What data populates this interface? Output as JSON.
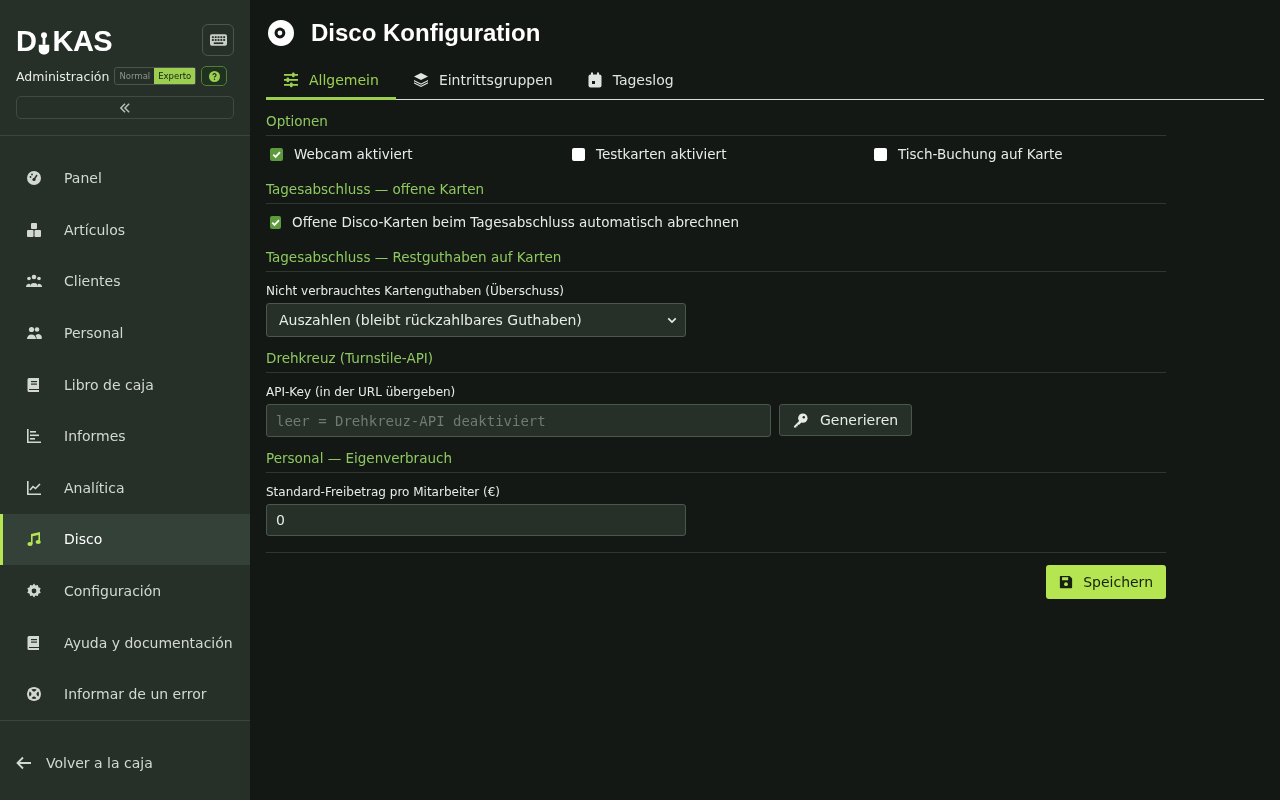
{
  "sidebar": {
    "logo": [
      "D",
      "KAS"
    ],
    "subtitle": "Administración",
    "mode_toggle": [
      {
        "label": "Normal",
        "selected": false
      },
      {
        "label": "Experto",
        "selected": true
      }
    ],
    "items": [
      {
        "label": "Panel",
        "selected": false
      },
      {
        "label": "Artículos",
        "selected": false
      },
      {
        "label": "Clientes",
        "selected": false
      },
      {
        "label": "Personal",
        "selected": false
      },
      {
        "label": "Libro de caja",
        "selected": false
      },
      {
        "label": "Informes",
        "selected": false
      },
      {
        "label": "Analítica",
        "selected": false
      },
      {
        "label": "Disco",
        "selected": true
      },
      {
        "label": "Configuración",
        "selected": false
      },
      {
        "label": "Ayuda y documentación",
        "selected": false
      },
      {
        "label": "Informar de un error",
        "selected": false
      }
    ],
    "back_link": "Volver a la caja"
  },
  "page": {
    "title": "Disco Konfiguration",
    "tabs": [
      {
        "label": "Allgemein",
        "selected": true
      },
      {
        "label": "Eintrittsgruppen",
        "selected": false
      },
      {
        "label": "Tageslog",
        "selected": false
      }
    ],
    "sections": [
      {
        "title": "Optionen",
        "kind": "checkboxes",
        "items": [
          {
            "label": "Webcam aktiviert",
            "checked": true
          },
          {
            "label": "Testkarten aktiviert",
            "checked": false
          },
          {
            "label": "Tisch-Buchung auf Karte",
            "checked": false
          }
        ]
      },
      {
        "title": "Tagesabschluss — offene Karten",
        "kind": "checkboxes",
        "items": [
          {
            "label": "Offene Disco-Karten beim Tagesabschluss automatisch abrechnen",
            "checked": true
          }
        ]
      },
      {
        "title": "Tagesabschluss — Restguthaben auf Karten",
        "kind": "select",
        "label": "Nicht verbrauchtes Kartenguthaben (Überschuss)",
        "value": "Auszahlen (bleibt rückzahlbares Guthaben)"
      },
      {
        "title": "Drehkreuz (Turnstile-API)",
        "kind": "key",
        "label": "API-Key (in der URL übergeben)",
        "placeholder": "leer = Drehkreuz-API deaktiviert",
        "button": "Generieren"
      },
      {
        "title": "Personal — Eigenverbrauch",
        "kind": "number",
        "label": "Standard-Freibetrag pro Mitarbeiter (€)",
        "value": "0"
      }
    ],
    "save_button": "Speichern"
  }
}
